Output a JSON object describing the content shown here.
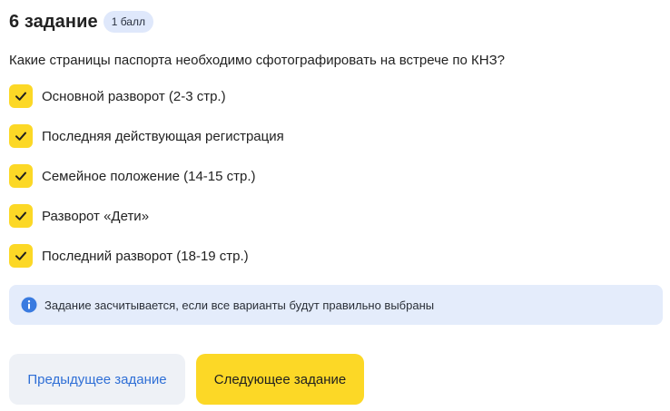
{
  "task": {
    "title": "6 задание",
    "points": "1 балл"
  },
  "question": "Какие страницы паспорта необходимо сфотографировать на встрече по КНЗ?",
  "options": [
    {
      "label": "Основной разворот (2-3 стр.)",
      "checked": true
    },
    {
      "label": "Последняя действующая регистрация",
      "checked": true
    },
    {
      "label": "Семейное положение (14-15 стр.)",
      "checked": true
    },
    {
      "label": "Разворот «Дети»",
      "checked": true
    },
    {
      "label": "Последний разворот (18-19 стр.)",
      "checked": true
    }
  ],
  "info": {
    "icon": "info-icon",
    "text": "Задание засчитывается, если все варианты будут правильно выбраны"
  },
  "buttons": {
    "prev_label": "Предыдущее задание",
    "next_label": "Следующее задание"
  },
  "colors": {
    "accent_yellow": "#fcd826",
    "badge_bg": "#dfe8fb",
    "info_bg": "#e4ecfb",
    "info_icon": "#3a7be0",
    "link_blue": "#2f6fd6",
    "secondary_button_bg": "#eef1f6"
  }
}
